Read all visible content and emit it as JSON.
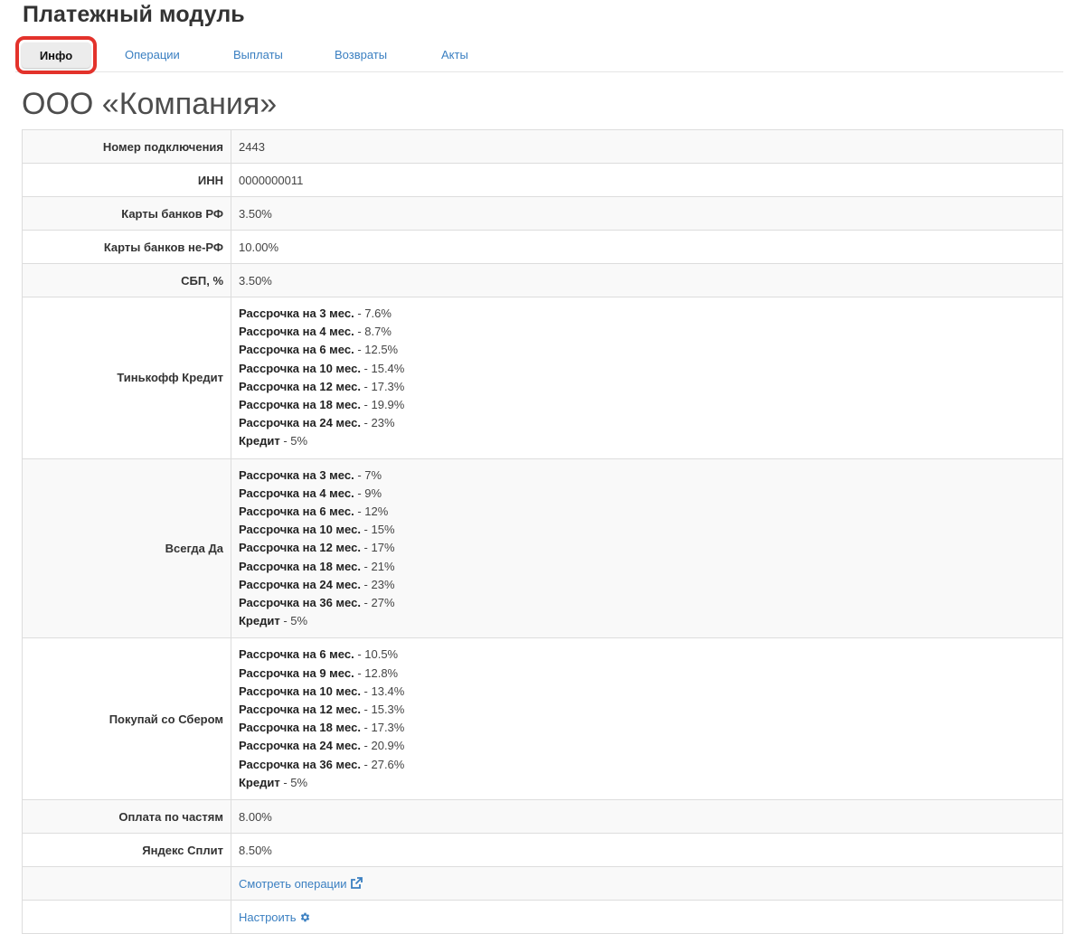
{
  "header": {
    "title": "Платежный модуль"
  },
  "tabs": [
    {
      "label": "Инфо",
      "active": true
    },
    {
      "label": "Операции"
    },
    {
      "label": "Выплаты"
    },
    {
      "label": "Возвраты"
    },
    {
      "label": "Акты"
    }
  ],
  "company": {
    "name": "ООО «Компания»"
  },
  "info": {
    "connection_number": {
      "label": "Номер подключения",
      "value": "2443"
    },
    "inn": {
      "label": "ИНН",
      "value": "0000000011"
    },
    "cards_rf": {
      "label": "Карты банков РФ",
      "value": "3.50%"
    },
    "cards_non_rf": {
      "label": "Карты банков не-РФ",
      "value": "10.00%"
    },
    "sbp": {
      "label": "СБП, %",
      "value": "3.50%"
    },
    "tinkoff": {
      "label": "Тинькофф Кредит",
      "plans": [
        {
          "name": "Рассрочка на 3 мес.",
          "rate": " - 7.6%"
        },
        {
          "name": "Рассрочка на 4 мес.",
          "rate": " - 8.7%"
        },
        {
          "name": "Рассрочка на 6 мес.",
          "rate": " - 12.5%"
        },
        {
          "name": "Рассрочка на 10 мес.",
          "rate": " - 15.4%"
        },
        {
          "name": "Рассрочка на 12 мес.",
          "rate": " - 17.3%"
        },
        {
          "name": "Рассрочка на 18 мес.",
          "rate": " - 19.9%"
        },
        {
          "name": "Рассрочка на 24 мес.",
          "rate": " - 23%"
        },
        {
          "name": "Кредит",
          "rate": " - 5%"
        }
      ]
    },
    "vsegda_da": {
      "label": "Всегда Да",
      "plans": [
        {
          "name": "Рассрочка на 3 мес.",
          "rate": " - 7%"
        },
        {
          "name": "Рассрочка на 4 мес.",
          "rate": " - 9%"
        },
        {
          "name": "Рассрочка на 6 мес.",
          "rate": " - 12%"
        },
        {
          "name": "Рассрочка на 10 мес.",
          "rate": " - 15%"
        },
        {
          "name": "Рассрочка на 12 мес.",
          "rate": " - 17%"
        },
        {
          "name": "Рассрочка на 18 мес.",
          "rate": " - 21%"
        },
        {
          "name": "Рассрочка на 24 мес.",
          "rate": " - 23%"
        },
        {
          "name": "Рассрочка на 36 мес.",
          "rate": " - 27%"
        },
        {
          "name": "Кредит",
          "rate": " - 5%"
        }
      ]
    },
    "sber": {
      "label": "Покупай со Сбером",
      "plans": [
        {
          "name": "Рассрочка на 6 мес.",
          "rate": " - 10.5%"
        },
        {
          "name": "Рассрочка на 9 мес.",
          "rate": " - 12.8%"
        },
        {
          "name": "Рассрочка на 10 мес.",
          "rate": " - 13.4%"
        },
        {
          "name": "Рассрочка на 12 мес.",
          "rate": " - 15.3%"
        },
        {
          "name": "Рассрочка на 18 мес.",
          "rate": " - 17.3%"
        },
        {
          "name": "Рассрочка на 24 мес.",
          "rate": " - 20.9%"
        },
        {
          "name": "Рассрочка на 36 мес.",
          "rate": " - 27.6%"
        },
        {
          "name": "Кредит",
          "rate": " - 5%"
        }
      ]
    },
    "parts": {
      "label": "Оплата по частям",
      "value": "8.00%"
    },
    "yandex_split": {
      "label": "Яндекс Сплит",
      "value": "8.50%"
    }
  },
  "links": {
    "view_operations": {
      "label": "Смотреть операции",
      "icon": "external-link-icon"
    },
    "configure": {
      "label": "Настроить",
      "icon": "gear-icon"
    }
  },
  "colors": {
    "link": "#3a7fc1",
    "active_tab_highlight": "#e3322b"
  }
}
